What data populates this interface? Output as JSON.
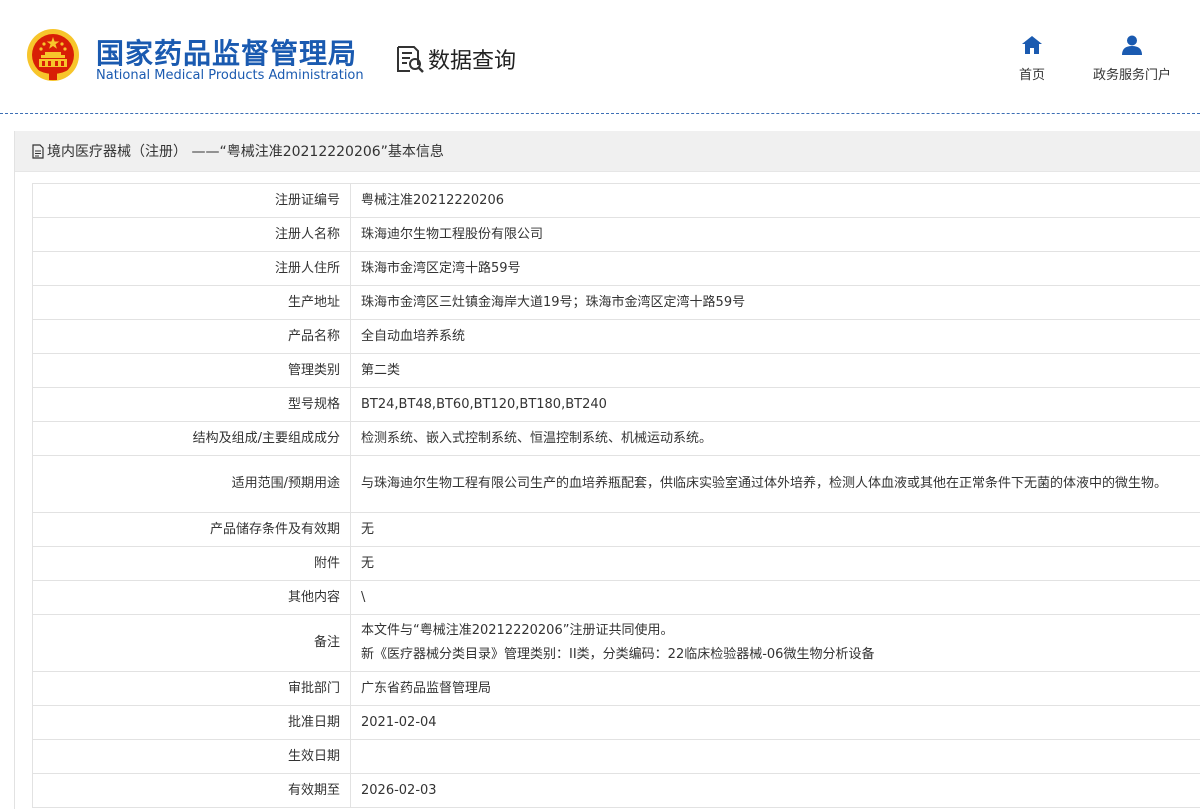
{
  "header": {
    "title_cn": "国家药品监督管理局",
    "title_en": "National Medical Products Administration",
    "query_label": "数据查询",
    "nav": {
      "home_label": "首页",
      "portal_label": "政务服务门户"
    },
    "colors": {
      "brand": "#1a5ab0",
      "emblem_red": "#d81e06",
      "emblem_gold": "#f7c52b"
    }
  },
  "panel": {
    "title": "境内医疗器械（注册） ——“粤械注准20212220206”基本信息"
  },
  "rows": [
    {
      "label": "注册证编号",
      "value": "粤械注准20212220206"
    },
    {
      "label": "注册人名称",
      "value": "珠海迪尔生物工程股份有限公司"
    },
    {
      "label": "注册人住所",
      "value": "珠海市金湾区定湾十路59号"
    },
    {
      "label": "生产地址",
      "value": "珠海市金湾区三灶镇金海岸大道19号；珠海市金湾区定湾十路59号"
    },
    {
      "label": "产品名称",
      "value": "全自动血培养系统"
    },
    {
      "label": "管理类别",
      "value": "第二类"
    },
    {
      "label": "型号规格",
      "value": "BT24,BT48,BT60,BT120,BT180,BT240"
    },
    {
      "label": "结构及组成/主要组成成分",
      "value": "检测系统、嵌入式控制系统、恒温控制系统、机械运动系统。"
    },
    {
      "label": "适用范围/预期用途",
      "value": "与珠海迪尔生物工程有限公司生产的血培养瓶配套，供临床实验室通过体外培养，检测人体血液或其他在正常条件下无菌的体液中的微生物。"
    },
    {
      "label": "产品储存条件及有效期",
      "value": "无"
    },
    {
      "label": "附件",
      "value": "无"
    },
    {
      "label": "其他内容",
      "value": "\\"
    },
    {
      "label": "备注",
      "value_line1": "本文件与“粤械注准20212220206”注册证共同使用。",
      "value_line2": "新《医疗器械分类目录》管理类别：II类，分类编码：22临床检验器械-06微生物分析设备"
    },
    {
      "label": "审批部门",
      "value": "广东省药品监督管理局"
    },
    {
      "label": "批准日期",
      "value": "2021-02-04"
    },
    {
      "label": "生效日期",
      "value": ""
    },
    {
      "label": "有效期至",
      "value": "2026-02-03"
    }
  ]
}
